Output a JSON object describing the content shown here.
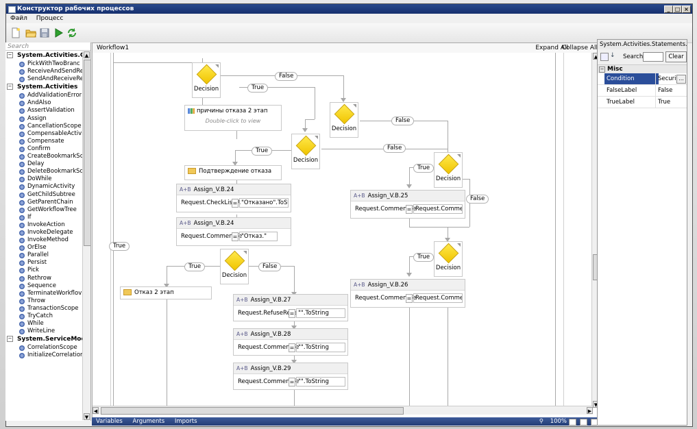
{
  "window": {
    "title": "Конструктор рабочих процессов"
  },
  "menu": [
    "Файл",
    "Процесс"
  ],
  "toolbox": {
    "search_placeholder": "Search",
    "categories": [
      {
        "name": "System.Activities.Core.",
        "items": [
          "PickWithTwoBranc",
          "ReceiveAndSendRe",
          "SendAndReceiveRe"
        ]
      },
      {
        "name": "System.Activities",
        "items": [
          "AddValidationError",
          "AndAlso",
          "AssertValidation",
          "Assign",
          "CancellationScope",
          "CompensableActivi",
          "Compensate",
          "Confirm",
          "CreateBookmarkSc",
          "Delay",
          "DeleteBookmarkSc",
          "DoWhile",
          "DynamicActivity",
          "GetChildSubtree",
          "GetParentChain",
          "GetWorkflowTree",
          "If",
          "InvokeAction",
          "InvokeDelegate",
          "InvokeMethod",
          "OrElse",
          "Parallel",
          "Persist",
          "Pick",
          "Rethrow",
          "Sequence",
          "TerminateWorkflov",
          "Throw",
          "TransactionScope",
          "TryCatch",
          "While",
          "WriteLine"
        ]
      },
      {
        "name": "System.ServiceModel.A",
        "items": [
          "CorrelationScope",
          "InitializeCorrelation"
        ]
      }
    ]
  },
  "designer": {
    "breadcrumb": "Workflow1",
    "expand_all": "Expand All",
    "collapse_all": "Collapse All",
    "decision_label": "Decision",
    "true_label": "True",
    "false_label": "False",
    "seq1": {
      "title": "причины отказа 2 этап",
      "hint": "Double-click to view"
    },
    "seq2": {
      "title": "Подтверждение отказа"
    },
    "seq3": {
      "title": "Отказ 2 этап"
    },
    "assigns": [
      {
        "title": "Assign_V.B.24",
        "lhs": "Request.CheckList.A",
        "rhs": "\"Отказано\".ToString"
      },
      {
        "title": "Assign_V.B.24",
        "lhs": "Request.CommentVe",
        "rhs": "\"Отказ.\""
      },
      {
        "title": "Assign_V.B.25",
        "lhs": "Request.CommentVe",
        "rhs": "Request.CommentVe"
      },
      {
        "title": "Assign_V.B.26",
        "lhs": "Request.CommentVe",
        "rhs": "Request.CommentVe"
      },
      {
        "title": "Assign_V.B.27",
        "lhs": "Request.RefuseReas",
        "rhs": "\"\".ToString"
      },
      {
        "title": "Assign_V.B.28",
        "lhs": "Request.CommentVe",
        "rhs": "\"\".ToString"
      },
      {
        "title": "Assign_V.B.29",
        "lhs": "Request.CommentVe",
        "rhs": "\"\".ToString"
      }
    ],
    "ab_glyph": "A+B",
    "eq": "="
  },
  "bottom": {
    "tabs": [
      "Variables",
      "Arguments",
      "Imports"
    ],
    "zoom": "100%"
  },
  "properties": {
    "title": "System.Activities.Statements.FlowD...",
    "search_label": "Search:",
    "clear": "Clear",
    "category": "Misc",
    "rows": [
      {
        "name": "Condition",
        "value": "Security"
      },
      {
        "name": "FalseLabel",
        "value": "False"
      },
      {
        "name": "TrueLabel",
        "value": "True"
      }
    ]
  }
}
